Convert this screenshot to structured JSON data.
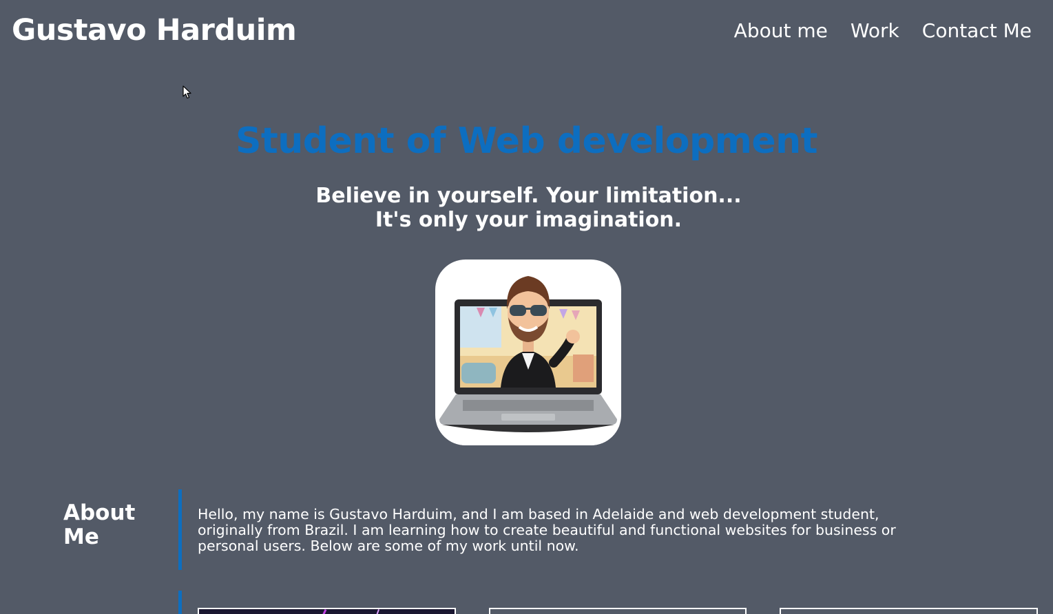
{
  "header": {
    "brand": "Gustavo Harduim",
    "nav": [
      "About me",
      "Work",
      "Contact Me"
    ]
  },
  "hero": {
    "title": "Student of Web development",
    "subtitle_line1": "Believe in yourself. Your limitation...",
    "subtitle_line2": "It's only your imagination."
  },
  "about": {
    "heading": "About Me",
    "text": "Hello, my name is Gustavo Harduim, and I am based in Adelaide and web development student, originally from Brazil. I am learning how to create beautiful and functional websites for business or personal users. Below are some of my work until now."
  },
  "colors": {
    "background": "#535a67",
    "accent": "#0d6ec0",
    "text": "#ffffff"
  },
  "icons": {
    "cursor": "mouse-pointer-icon",
    "avatar": "cartoon-avatar-in-laptop"
  }
}
